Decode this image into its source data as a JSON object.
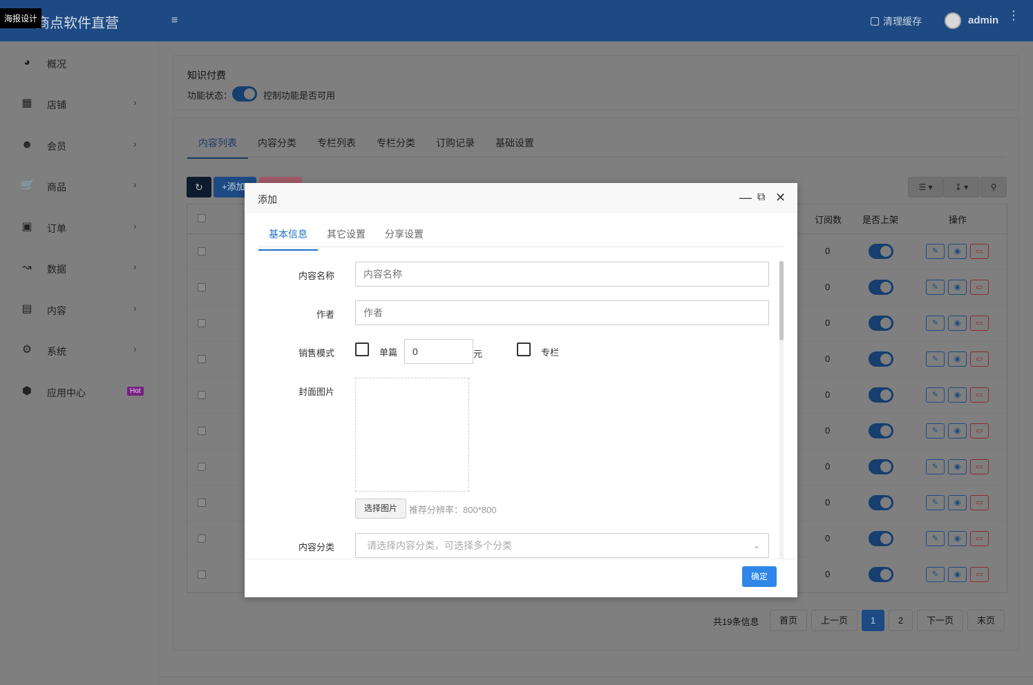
{
  "header": {
    "brand": "商点软件直营",
    "tooltip": "海报设计",
    "clear_cache": "清理缓存",
    "user": "admin"
  },
  "sidebar": {
    "items": [
      {
        "label": "概况",
        "icon": "dashboard-icon",
        "chevron": false
      },
      {
        "label": "店铺",
        "icon": "grid-icon",
        "chevron": true
      },
      {
        "label": "会员",
        "icon": "users-icon",
        "chevron": true
      },
      {
        "label": "商品",
        "icon": "cart-icon",
        "chevron": true
      },
      {
        "label": "订单",
        "icon": "money-icon",
        "chevron": true
      },
      {
        "label": "数据",
        "icon": "line-chart-icon",
        "chevron": true
      },
      {
        "label": "内容",
        "icon": "document-icon",
        "chevron": true
      },
      {
        "label": "系统",
        "icon": "gear-icon",
        "chevron": true
      },
      {
        "label": "应用中心",
        "icon": "cube-icon",
        "chevron": false,
        "badge": "Hot"
      }
    ]
  },
  "module": {
    "title": "知识付费",
    "status_label": "功能状态：",
    "status_on": true,
    "status_hint": "控制功能是否可用"
  },
  "tabs": [
    "内容列表",
    "内容分类",
    "专栏列表",
    "专栏分类",
    "订购记录",
    "基础设置"
  ],
  "toolbar": {
    "add_label": "+添加"
  },
  "table": {
    "headers": {
      "subscriptions": "订阅数",
      "on_shelf": "是否上架",
      "actions": "操作"
    },
    "rows": [
      {
        "subscriptions": "0",
        "on_shelf": true
      },
      {
        "subscriptions": "0",
        "on_shelf": true
      },
      {
        "subscriptions": "0",
        "on_shelf": true
      },
      {
        "subscriptions": "0",
        "on_shelf": true
      },
      {
        "subscriptions": "0",
        "on_shelf": true
      },
      {
        "subscriptions": "0",
        "on_shelf": true
      },
      {
        "subscriptions": "0",
        "on_shelf": true
      },
      {
        "subscriptions": "0",
        "on_shelf": true
      },
      {
        "subscriptions": "0",
        "on_shelf": true
      },
      {
        "subscriptions": "0",
        "on_shelf": true
      }
    ]
  },
  "pagination": {
    "info": "共19条信息",
    "first": "首页",
    "prev": "上一页",
    "pages": [
      "1",
      "2"
    ],
    "current": "1",
    "next": "下一页",
    "last": "末页"
  },
  "modal": {
    "title": "添加",
    "tabs": [
      "基本信息",
      "其它设置",
      "分享设置"
    ],
    "fields": {
      "name_label": "内容名称",
      "name_placeholder": "内容名称",
      "author_label": "作者",
      "author_placeholder": "作者",
      "sale_mode_label": "销售模式",
      "single_label": "单篇",
      "price_value": "0",
      "price_unit": "元",
      "column_label": "专栏",
      "cover_label": "封面图片",
      "pick_image": "选择图片",
      "pick_hint": "推荐分辨率：800*800",
      "category_label": "内容分类",
      "category_placeholder": "请选择内容分类，可选择多个分类"
    },
    "confirm": "确定"
  },
  "colors": {
    "accent": "#1e70c7",
    "confirm": "#2f86e8",
    "overlay": "#7f7f7f"
  }
}
